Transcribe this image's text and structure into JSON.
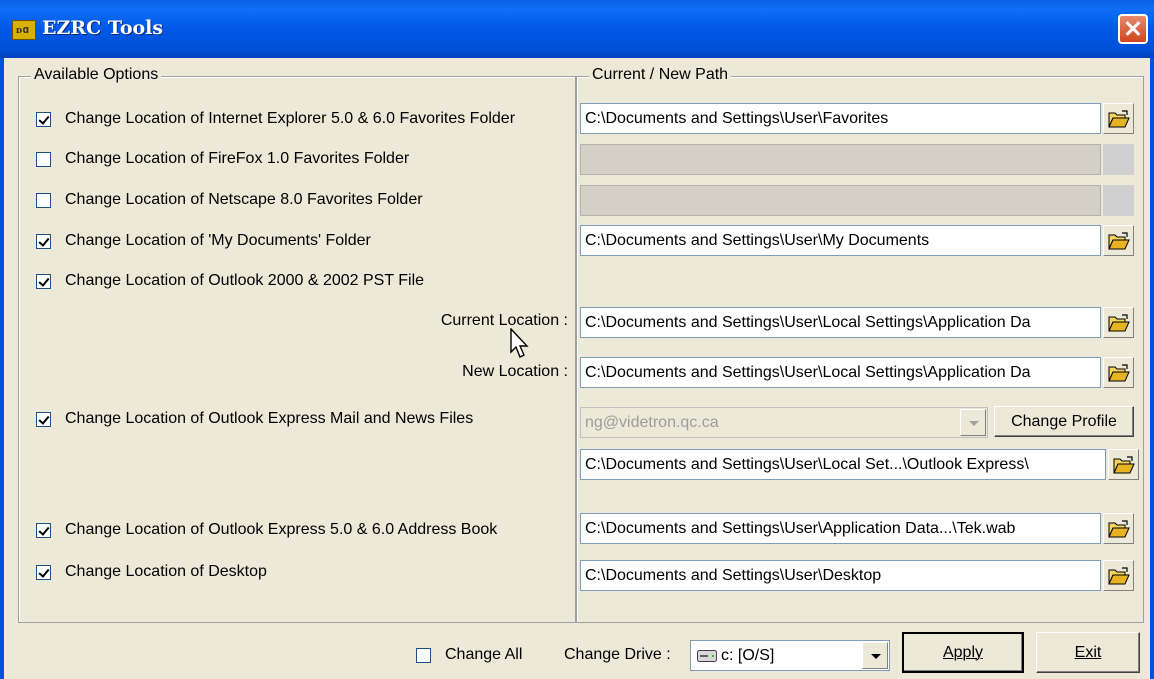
{
  "window": {
    "title": "EZRC Tools",
    "icon": "app-icon"
  },
  "groups": {
    "options_label": "Available Options",
    "path_label": "Current / New Path"
  },
  "rows": [
    {
      "label": "Change Location of Internet Explorer 5.0 & 6.0 Favorites Folder",
      "checked": true,
      "path": "C:\\Documents and Settings\\User\\Favorites"
    },
    {
      "label": "Change Location of FireFox 1.0  Favorites Folder",
      "checked": false,
      "path": ""
    },
    {
      "label": "Change Location of Netscape 8.0 Favorites Folder",
      "checked": false,
      "path": ""
    },
    {
      "label": "Change Location of 'My Documents' Folder",
      "checked": true,
      "path": "C:\\Documents and Settings\\User\\My Documents"
    },
    {
      "label": "Change Location of Outlook 2000 & 2002 PST File",
      "checked": true
    },
    {
      "label": "Change Location of Outlook Express Mail and News Files",
      "checked": true
    },
    {
      "label": "Change Location of Outlook Express 5.0 & 6.0 Address Book",
      "checked": true,
      "path": "C:\\Documents and Settings\\User\\Application Data...\\Tek.wab"
    },
    {
      "label": "Change Location of Desktop",
      "checked": true,
      "path": "C:\\Documents and Settings\\User\\Desktop"
    }
  ],
  "pst": {
    "current_label": "Current Location :",
    "current_path": "C:\\Documents and Settings\\User\\Local Settings\\Application Da",
    "new_label": "New Location :",
    "new_path": "C:\\Documents and Settings\\User\\Local Settings\\Application Da"
  },
  "oe": {
    "profile_value": "ng@videtron.qc.ca",
    "change_profile_label": "Change Profile",
    "path": "C:\\Documents and Settings\\User\\Local Set...\\Outlook Express\\"
  },
  "footer": {
    "change_all_label": "Change All",
    "change_all_checked": false,
    "change_drive_label": "Change Drive :",
    "drive_value": "c: [O/S]",
    "apply_label": "Apply",
    "exit_label": "Exit"
  }
}
